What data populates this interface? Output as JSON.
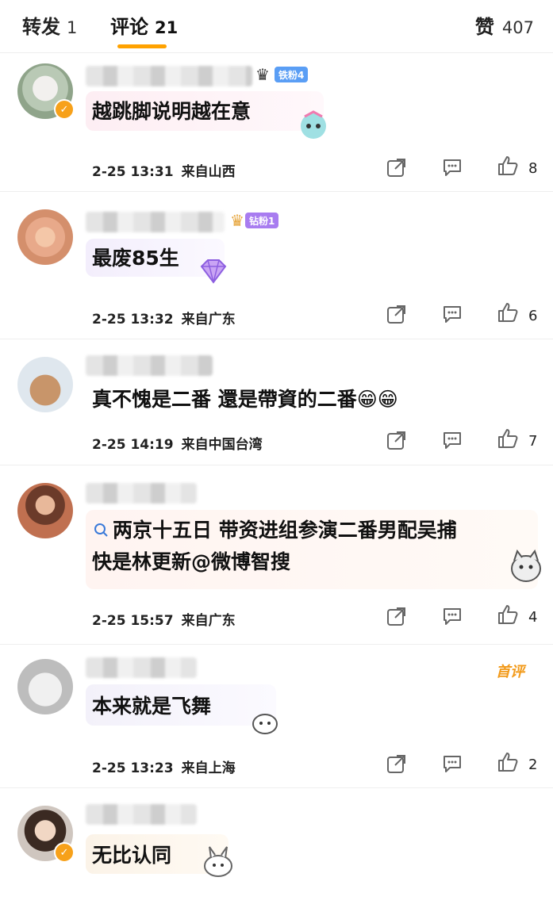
{
  "tabs": {
    "repost": {
      "label": "转发",
      "count": "1"
    },
    "comments": {
      "label": "评论",
      "count": "21"
    },
    "likes": {
      "label": "赞",
      "count": "407"
    }
  },
  "accent_color": "#ffa200",
  "comments": [
    {
      "text": "越跳脚说明越在意",
      "time": "2-25 13:31",
      "location": "来自山西",
      "likes": "8",
      "badge": "铁粉4",
      "badge_color": "#5a9ef5"
    },
    {
      "text": "最废85生",
      "time": "2-25 13:32",
      "location": "来自广东",
      "likes": "6",
      "badge": "钻粉1",
      "badge_color": "#a87cf0"
    },
    {
      "text": "真不愧是二番 還是帶資的二番😁😁",
      "time": "2-25 14:19",
      "location": "来自中国台湾",
      "likes": "7"
    },
    {
      "line1": "两京十五日 带资进组参演二番男配吴捕",
      "line2": "快是林更新@微博智搜",
      "time": "2-25 15:57",
      "location": "来自广东",
      "likes": "4"
    },
    {
      "text": "本来就是飞舞",
      "time": "2-25 13:23",
      "location": "来自上海",
      "likes": "2",
      "tag": "首评"
    },
    {
      "text": "无比认同"
    }
  ],
  "icons": [
    "repost-icon",
    "comment-icon",
    "like-icon",
    "search-icon",
    "verified-icon"
  ]
}
